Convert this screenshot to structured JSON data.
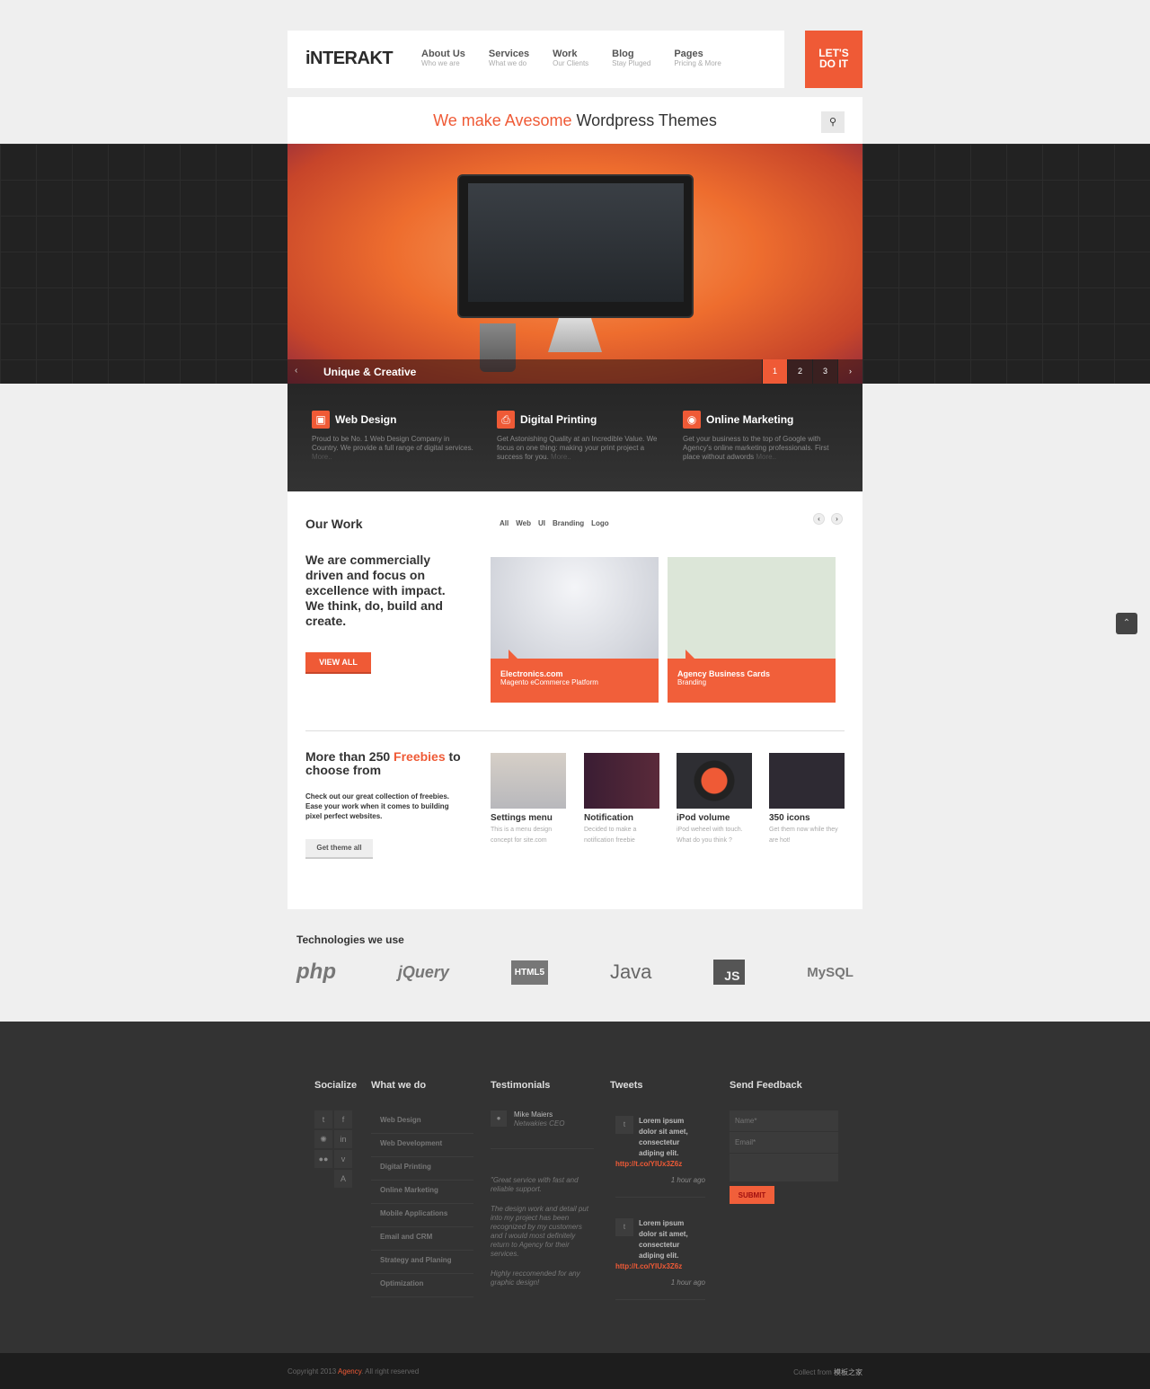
{
  "header": {
    "logo": "iNTERAKT",
    "nav": [
      {
        "title": "About Us",
        "sub": "Who we are"
      },
      {
        "title": "Services",
        "sub": "What we do"
      },
      {
        "title": "Work",
        "sub": "Our Clients"
      },
      {
        "title": "Blog",
        "sub": "Stay Pluged"
      },
      {
        "title": "Pages",
        "sub": "Pricing & More"
      }
    ],
    "cta_line1": "LET'S",
    "cta_line2": "DO IT"
  },
  "tagline": {
    "highlight": "We make Avesome",
    "rest": " Wordpress Themes"
  },
  "slider": {
    "caption": "Unique & Creative",
    "pages": [
      "1",
      "2",
      "3"
    ],
    "active": 1,
    "prev": "‹",
    "next": "›"
  },
  "services": [
    {
      "icon": "monitor-icon",
      "title": "Web Design",
      "text": "Proud to be No. 1 Web Design Company in Country. We provide a full range of digital services.",
      "more": "More.."
    },
    {
      "icon": "printer-icon",
      "title": "Digital Printing",
      "text": "Get Astonishing Quality at an Incredible Value. We focus on one thing: making your print project a success for you.",
      "more": "More.."
    },
    {
      "icon": "globe-icon",
      "title": "Online Marketing",
      "text": "Get your business to the top of Google with Agency's online marketing professionals. First place without adwords",
      "more": "More.."
    }
  ],
  "work": {
    "title": "Our Work",
    "filters": [
      "All",
      "Web",
      "UI",
      "Branding",
      "Logo"
    ],
    "text": "We are commercially driven and focus on excellence with impact. We think, do, build and create.",
    "button": "VIEW ALL",
    "items": [
      {
        "title": "Electronics.com",
        "sub": "Magento eCommerce Platform"
      },
      {
        "title": "Agency Business Cards",
        "sub": "Branding"
      }
    ]
  },
  "freebies": {
    "pre": "More than 250 ",
    "hl": "Freebies",
    "post": " to choose from",
    "text": "Check out our great collection of freebies. Ease your work when it comes to building pixel perfect websites.",
    "button": "Get theme all",
    "items": [
      {
        "title": "Settings menu",
        "text": "This is a menu design concept for site.com"
      },
      {
        "title": "Notification",
        "text": "Decided to make a notification freebie"
      },
      {
        "title": "iPod volume",
        "text": "iPod weheel with touch. What do you think ?"
      },
      {
        "title": "350 icons",
        "text": "Get them now while they are hot!"
      }
    ]
  },
  "technologies": {
    "title": "Technologies we use",
    "items": [
      "php",
      "jQuery",
      "HTML5",
      "Java",
      "JS",
      "MySQL"
    ]
  },
  "footer": {
    "socialize": "Socialize",
    "what": "What we do",
    "what_items": [
      "Web Design",
      "Web Development",
      "Digital Printing",
      "Online Marketing",
      "Mobile Applications",
      "Email and CRM",
      "Strategy and Planing",
      "Optimization"
    ],
    "testimonials": "Testimonials",
    "testi_name": "Mike Maiers",
    "testi_role": "Netwakies CEO",
    "testi_quotes": [
      "\"Great service with fast and reliable support.",
      "The design work and detail put into my project has been recognized by my customers and I would most definitely return to Agency for their services.",
      "Highly reccomended for any graphic design!"
    ],
    "tweets_title": "Tweets",
    "tweets": [
      {
        "text": "Lorem ipsum dolor sit amet, consectetur adiping elit.",
        "link": "http://t.co/YlUx3Z6z",
        "time": "1 hour ago"
      },
      {
        "text": "Lorem ipsum dolor sit amet, consectetur adiping elit.",
        "link": "http://t.co/YlUx3Z6z",
        "time": "1 hour ago"
      }
    ],
    "feedback": "Send Feedback",
    "name_ph": "Name*",
    "email_ph": "Email*",
    "submit": "SUBMIT"
  },
  "bottom": {
    "copy_pre": "Copyright 2013 ",
    "brand": "Agency",
    "copy_post": ". All right reserved",
    "collect_pre": "Collect from ",
    "collect_site": "模板之家"
  },
  "colors": {
    "accent": "#ef5a36",
    "dark": "#333333"
  }
}
